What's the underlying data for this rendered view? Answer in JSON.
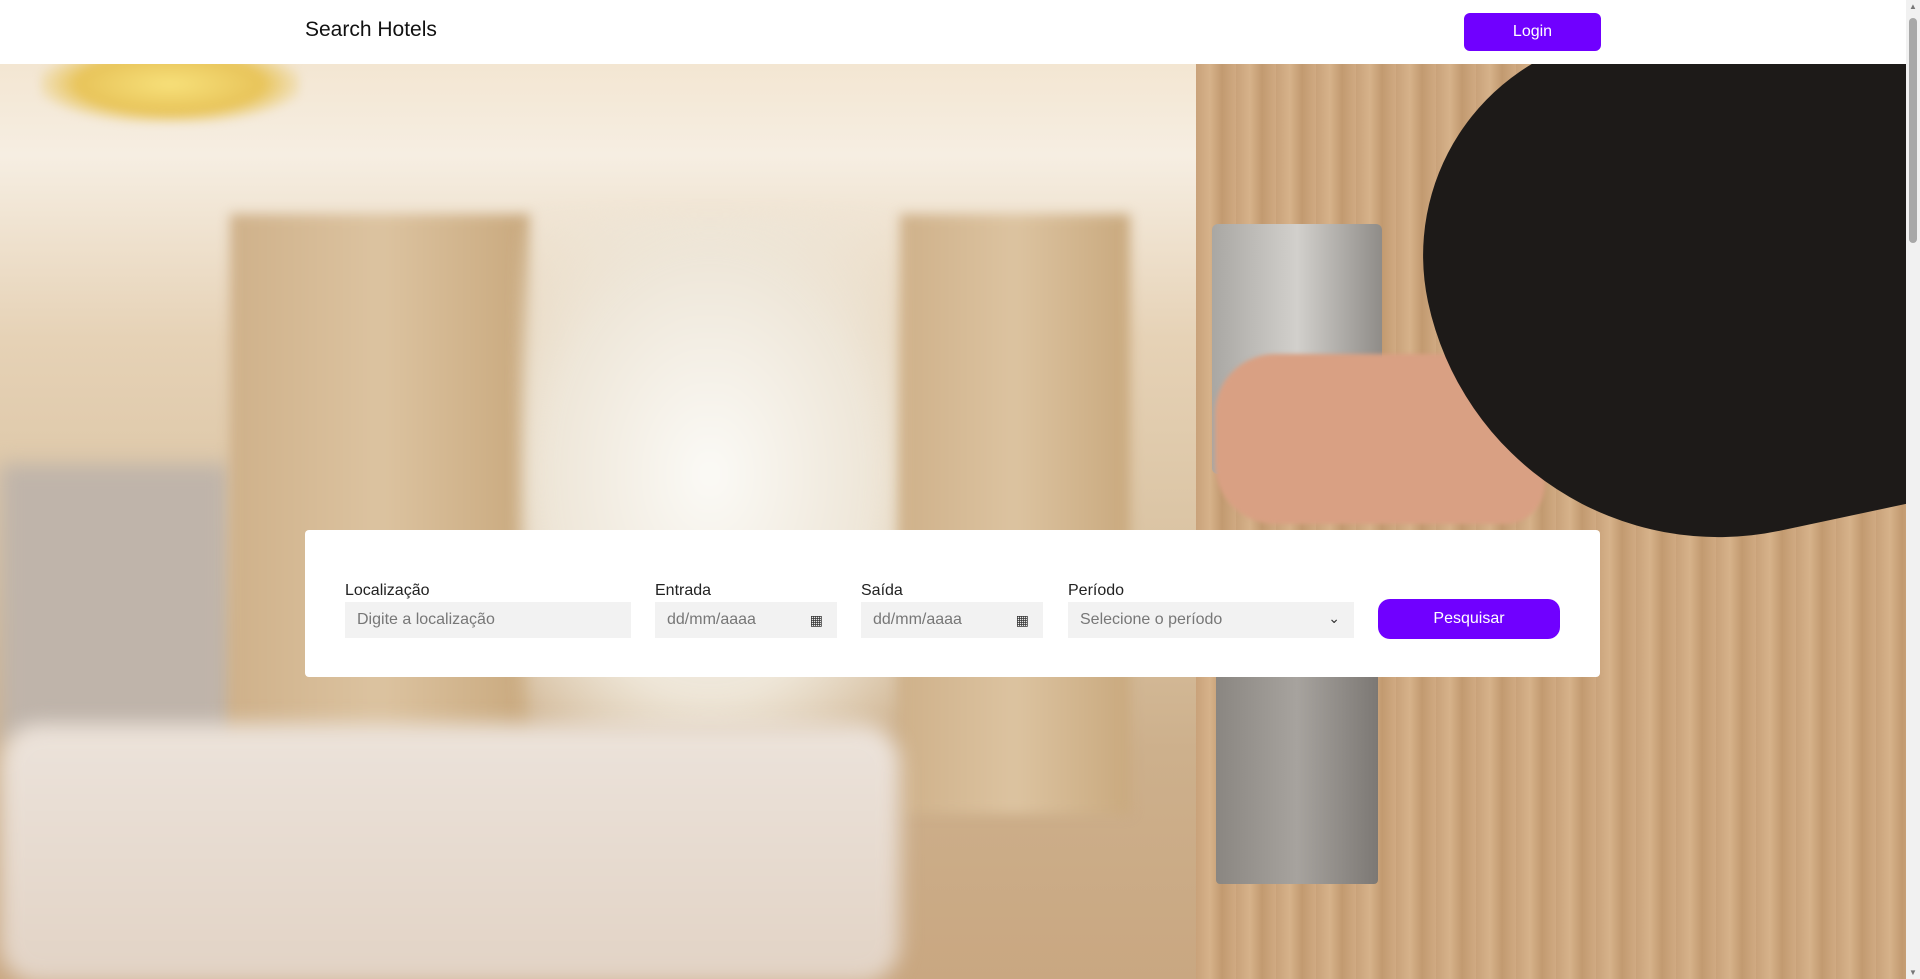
{
  "header": {
    "title": "Search Hotels",
    "login_label": "Login"
  },
  "search": {
    "location": {
      "label": "Localização",
      "placeholder": "Digite a localização"
    },
    "checkin": {
      "label": "Entrada",
      "placeholder": "dd/mm/aaaa"
    },
    "checkout": {
      "label": "Saída",
      "placeholder": "dd/mm/aaaa"
    },
    "period": {
      "label": "Período",
      "placeholder": "Selecione o período"
    },
    "submit_label": "Pesquisar"
  },
  "colors": {
    "accent": "#7000ff"
  }
}
